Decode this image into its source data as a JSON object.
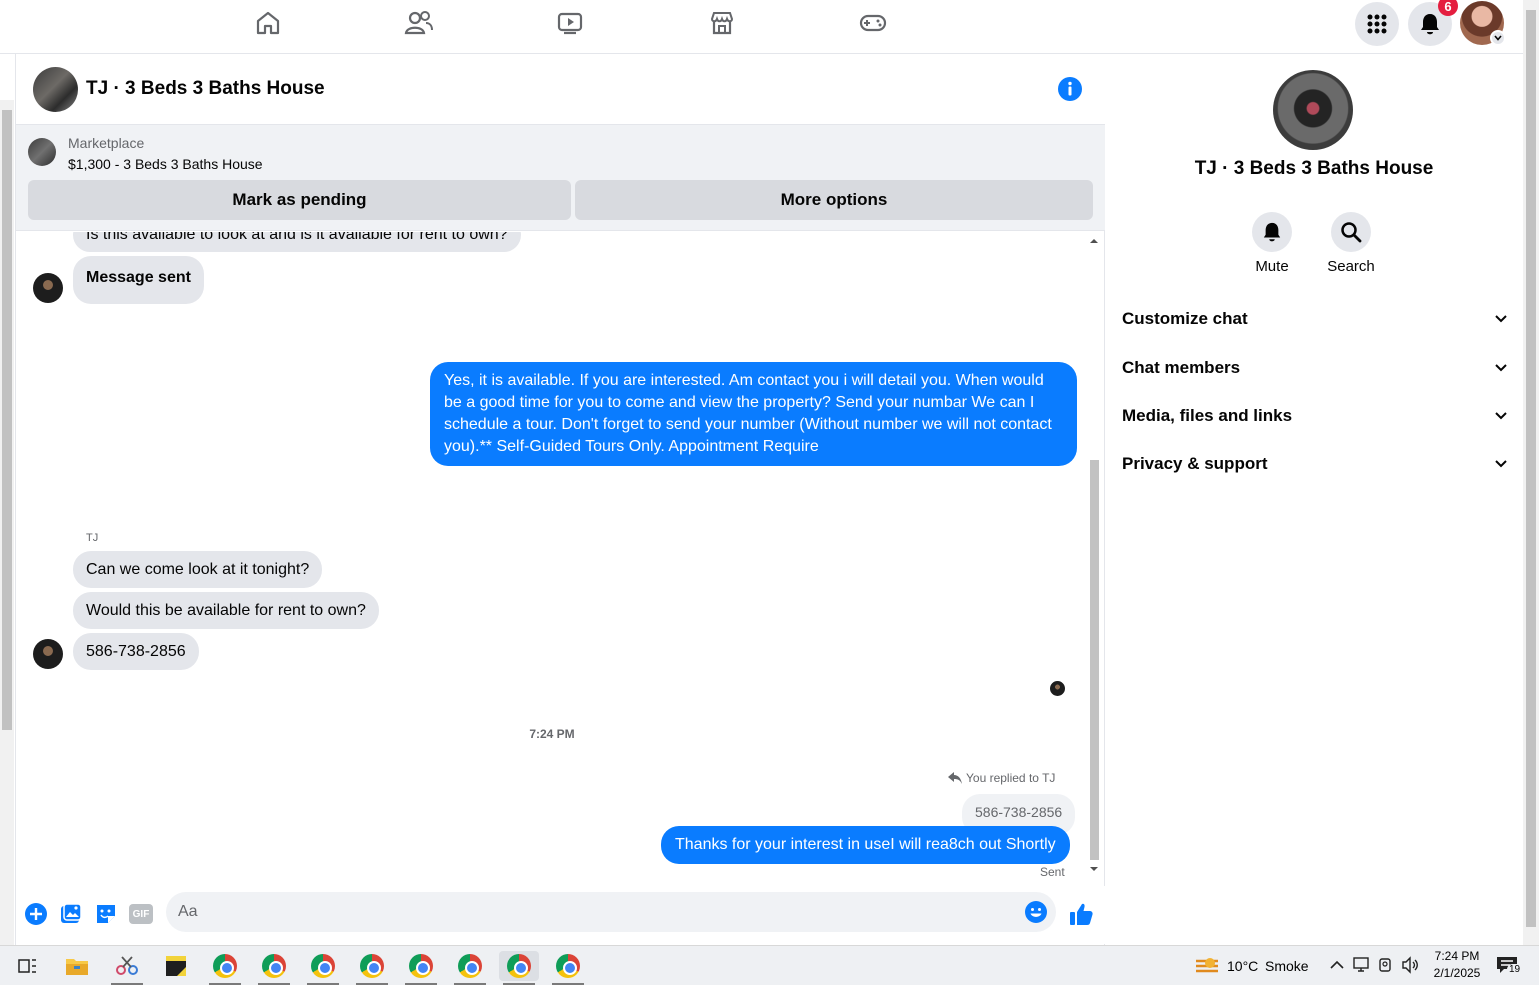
{
  "topnav": {
    "icons": [
      "home-icon",
      "friends-icon",
      "watch-icon",
      "marketplace-icon",
      "gaming-icon"
    ],
    "notifications_count": "6"
  },
  "chat": {
    "title": "TJ · 3 Beds 3 Baths House",
    "marketplace": {
      "label": "Marketplace",
      "item": "$1,300 - 3 Beds 3 Baths House",
      "mark_pending": "Mark as pending",
      "more_options": "More options"
    },
    "messages": {
      "partial_top": "Is this available to look at and is it available for rent to own?",
      "message_sent": "Message sent",
      "outgoing_long": "Yes, it is available. If you are interested.  Am contact you i will detail you.  When would be a good time for you to come and view the property? Send your numbar We can I schedule a tour.  Don't forget to send your number (Without number we will not contact you).** Self-Guided Tours Only. Appointment Require",
      "sender_name": "TJ",
      "incoming_1": "Can we come look at it tonight?",
      "incoming_2": "Would this be available for rent to own?",
      "incoming_3": "586-738-2856",
      "timestamp": "7:24 PM",
      "replied_to": "You replied to TJ",
      "quoted": "586-738-2856",
      "outgoing_last": "Thanks for your interest in useI will rea8ch out Shortly",
      "status": "Sent"
    },
    "composer": {
      "placeholder": "Aa",
      "gif_label": "GIF"
    }
  },
  "info_panel": {
    "title": "TJ · 3 Beds 3 Baths House",
    "mute_label": "Mute",
    "search_label": "Search",
    "sections": [
      "Customize chat",
      "Chat members",
      "Media, files and links",
      "Privacy & support"
    ]
  },
  "taskbar": {
    "weather_temp": "10°C",
    "weather_desc": "Smoke",
    "time": "7:24 PM",
    "date": "2/1/2025",
    "notifications": "19"
  },
  "colors": {
    "accent": "#0a7cff",
    "badge": "#e41e3f",
    "bubble_in": "#e4e6eb"
  }
}
